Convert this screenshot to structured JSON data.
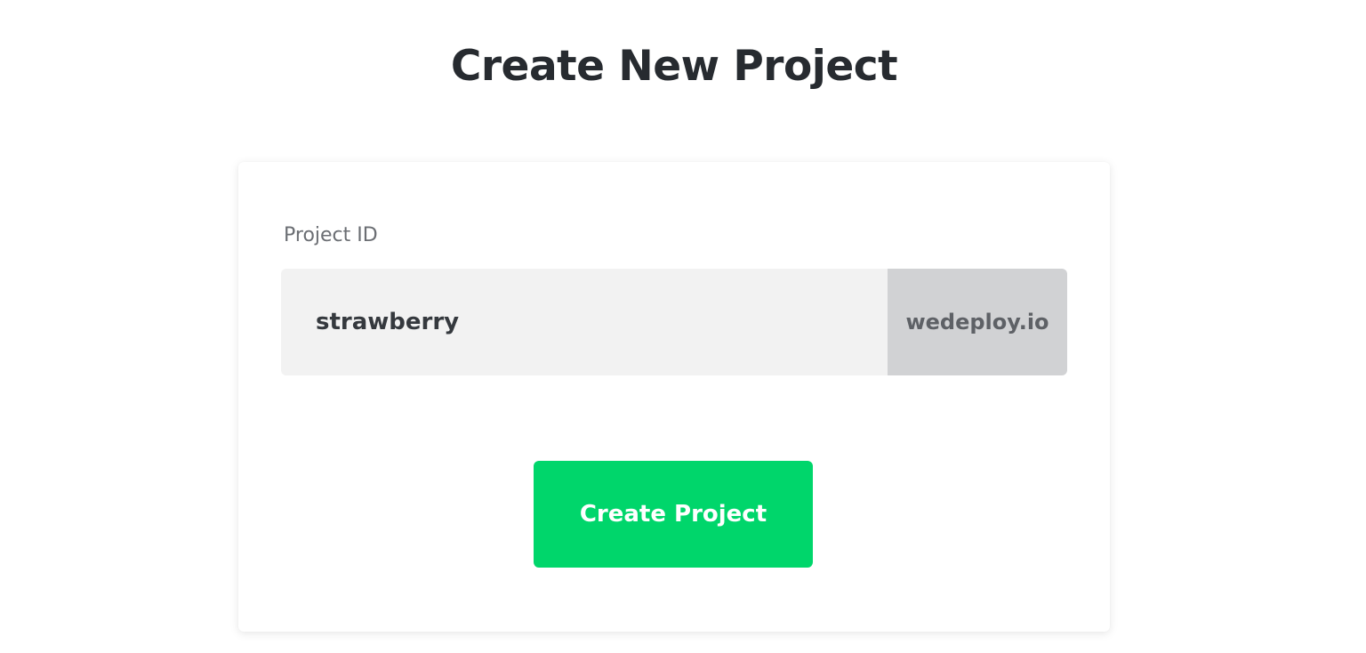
{
  "page": {
    "title": "Create New Project"
  },
  "form": {
    "project_id_label": "Project ID",
    "project_id_value": "strawberry",
    "domain_suffix": "wedeploy.io",
    "submit_label": "Create Project"
  },
  "colors": {
    "accent": "#00d66b",
    "input_background": "#f2f2f2",
    "suffix_background": "#d1d2d4",
    "title_text": "#272b30"
  }
}
